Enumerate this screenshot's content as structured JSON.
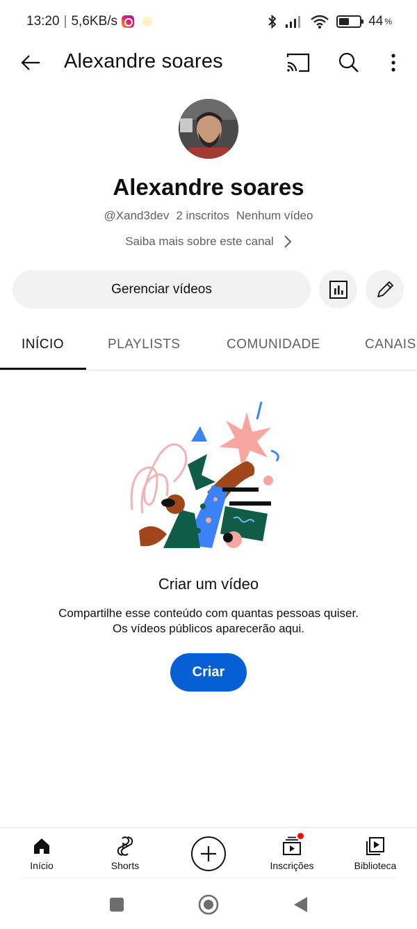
{
  "status_bar": {
    "time": "13:20",
    "separator": "|",
    "speed": "5,6KB/s",
    "battery_percent": "44",
    "battery_symbol": "%"
  },
  "app_bar": {
    "title": "Alexandre soares"
  },
  "channel": {
    "name": "Alexandre soares",
    "handle": "@Xand3dev",
    "subscribers": "2 inscritos",
    "videos": "Nenhum vídeo",
    "about_link": "Saiba mais sobre este canal"
  },
  "actions": {
    "manage_videos": "Gerenciar vídeos"
  },
  "tabs": [
    {
      "label": "INÍCIO",
      "active": true
    },
    {
      "label": "PLAYLISTS",
      "active": false
    },
    {
      "label": "COMUNIDADE",
      "active": false
    },
    {
      "label": "CANAIS",
      "active": false
    }
  ],
  "empty_state": {
    "title": "Criar um vídeo",
    "line1": "Compartilhe esse conteúdo com quantas pessoas quiser.",
    "line2": "Os vídeos públicos aparecerão aqui.",
    "button": "Criar"
  },
  "bottom_nav": {
    "home": "Início",
    "shorts": "Shorts",
    "subscriptions": "Inscrições",
    "library": "Biblioteca"
  },
  "colors": {
    "accent": "#065fd4",
    "notification": "#ff0000"
  }
}
